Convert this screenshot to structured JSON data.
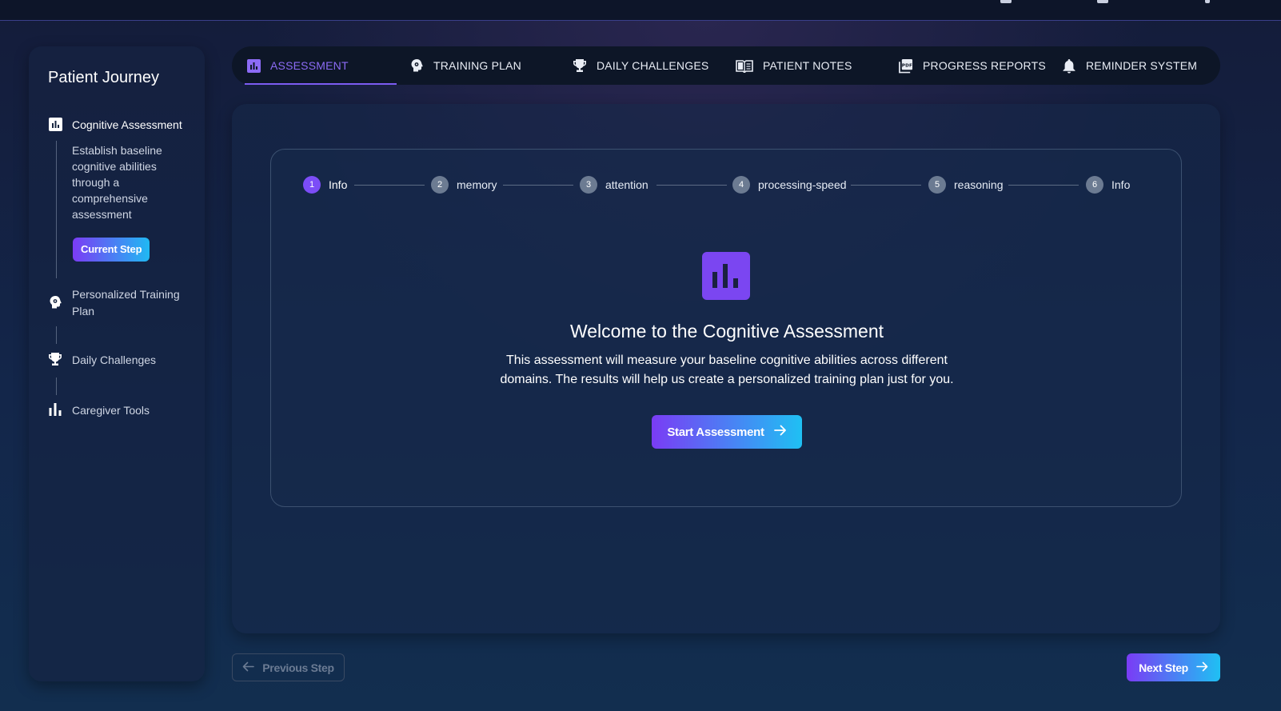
{
  "sidebar": {
    "title": "Patient Journey",
    "steps": [
      {
        "label": "Cognitive Assessment",
        "icon": "assessment-icon",
        "description": "Establish baseline cognitive abilities through a comprehensive assessment",
        "badge": "Current Step"
      },
      {
        "label": "Personalized Training Plan",
        "icon": "brain-icon"
      },
      {
        "label": "Daily Challenges",
        "icon": "trophy-icon"
      },
      {
        "label": "Caregiver Tools",
        "icon": "bar-chart-icon"
      }
    ]
  },
  "tabs": [
    {
      "label": "ASSESSMENT",
      "icon": "assessment-icon",
      "active": true
    },
    {
      "label": "TRAINING PLAN",
      "icon": "brain-icon"
    },
    {
      "label": "DAILY CHALLENGES",
      "icon": "trophy-icon"
    },
    {
      "label": "PATIENT NOTES",
      "icon": "book-icon"
    },
    {
      "label": "PROGRESS REPORTS",
      "icon": "pdf-icon"
    },
    {
      "label": "REMINDER SYSTEM",
      "icon": "bell-icon"
    }
  ],
  "stepper": [
    {
      "num": "1",
      "label": "Info",
      "active": true
    },
    {
      "num": "2",
      "label": "memory"
    },
    {
      "num": "3",
      "label": "attention"
    },
    {
      "num": "4",
      "label": "processing-speed"
    },
    {
      "num": "5",
      "label": "reasoning"
    },
    {
      "num": "6",
      "label": "Info"
    }
  ],
  "main": {
    "title": "Welcome to the Cognitive Assessment",
    "description": "This assessment will measure your baseline cognitive abilities across different domains. The results will help us create a personalized training plan just for you.",
    "start_button": "Start Assessment"
  },
  "nav": {
    "previous": "Previous Step",
    "next": "Next Step"
  },
  "colors": {
    "accent": "#7c4df7",
    "gradient_start": "#7a3cf5",
    "gradient_end": "#1fc0f3"
  }
}
